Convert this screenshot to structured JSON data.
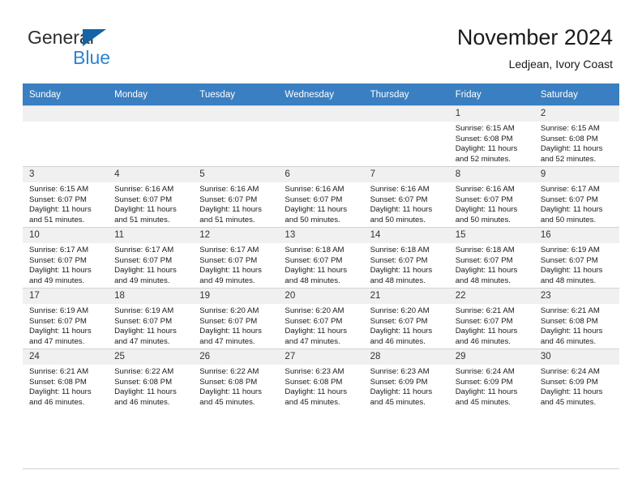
{
  "brand": {
    "name_part1": "General",
    "name_part2": "Blue",
    "logo_icon": "blue-triangle-logo"
  },
  "header": {
    "title": "November 2024",
    "subtitle": "Ledjean, Ivory Coast"
  },
  "calendar": {
    "weekday_headers": [
      "Sunday",
      "Monday",
      "Tuesday",
      "Wednesday",
      "Thursday",
      "Friday",
      "Saturday"
    ],
    "labels": {
      "sunrise_prefix": "Sunrise:",
      "sunset_prefix": "Sunset:",
      "daylight_prefix": "Daylight:"
    },
    "weeks": [
      [
        {
          "day": "",
          "empty": true
        },
        {
          "day": "",
          "empty": true
        },
        {
          "day": "",
          "empty": true
        },
        {
          "day": "",
          "empty": true
        },
        {
          "day": "",
          "empty": true
        },
        {
          "day": "1",
          "sunrise": "Sunrise: 6:15 AM",
          "sunset": "Sunset: 6:08 PM",
          "daylight": "Daylight: 11 hours and 52 minutes."
        },
        {
          "day": "2",
          "sunrise": "Sunrise: 6:15 AM",
          "sunset": "Sunset: 6:08 PM",
          "daylight": "Daylight: 11 hours and 52 minutes."
        }
      ],
      [
        {
          "day": "3",
          "sunrise": "Sunrise: 6:15 AM",
          "sunset": "Sunset: 6:07 PM",
          "daylight": "Daylight: 11 hours and 51 minutes."
        },
        {
          "day": "4",
          "sunrise": "Sunrise: 6:16 AM",
          "sunset": "Sunset: 6:07 PM",
          "daylight": "Daylight: 11 hours and 51 minutes."
        },
        {
          "day": "5",
          "sunrise": "Sunrise: 6:16 AM",
          "sunset": "Sunset: 6:07 PM",
          "daylight": "Daylight: 11 hours and 51 minutes."
        },
        {
          "day": "6",
          "sunrise": "Sunrise: 6:16 AM",
          "sunset": "Sunset: 6:07 PM",
          "daylight": "Daylight: 11 hours and 50 minutes."
        },
        {
          "day": "7",
          "sunrise": "Sunrise: 6:16 AM",
          "sunset": "Sunset: 6:07 PM",
          "daylight": "Daylight: 11 hours and 50 minutes."
        },
        {
          "day": "8",
          "sunrise": "Sunrise: 6:16 AM",
          "sunset": "Sunset: 6:07 PM",
          "daylight": "Daylight: 11 hours and 50 minutes."
        },
        {
          "day": "9",
          "sunrise": "Sunrise: 6:17 AM",
          "sunset": "Sunset: 6:07 PM",
          "daylight": "Daylight: 11 hours and 50 minutes."
        }
      ],
      [
        {
          "day": "10",
          "sunrise": "Sunrise: 6:17 AM",
          "sunset": "Sunset: 6:07 PM",
          "daylight": "Daylight: 11 hours and 49 minutes."
        },
        {
          "day": "11",
          "sunrise": "Sunrise: 6:17 AM",
          "sunset": "Sunset: 6:07 PM",
          "daylight": "Daylight: 11 hours and 49 minutes."
        },
        {
          "day": "12",
          "sunrise": "Sunrise: 6:17 AM",
          "sunset": "Sunset: 6:07 PM",
          "daylight": "Daylight: 11 hours and 49 minutes."
        },
        {
          "day": "13",
          "sunrise": "Sunrise: 6:18 AM",
          "sunset": "Sunset: 6:07 PM",
          "daylight": "Daylight: 11 hours and 48 minutes."
        },
        {
          "day": "14",
          "sunrise": "Sunrise: 6:18 AM",
          "sunset": "Sunset: 6:07 PM",
          "daylight": "Daylight: 11 hours and 48 minutes."
        },
        {
          "day": "15",
          "sunrise": "Sunrise: 6:18 AM",
          "sunset": "Sunset: 6:07 PM",
          "daylight": "Daylight: 11 hours and 48 minutes."
        },
        {
          "day": "16",
          "sunrise": "Sunrise: 6:19 AM",
          "sunset": "Sunset: 6:07 PM",
          "daylight": "Daylight: 11 hours and 48 minutes."
        }
      ],
      [
        {
          "day": "17",
          "sunrise": "Sunrise: 6:19 AM",
          "sunset": "Sunset: 6:07 PM",
          "daylight": "Daylight: 11 hours and 47 minutes."
        },
        {
          "day": "18",
          "sunrise": "Sunrise: 6:19 AM",
          "sunset": "Sunset: 6:07 PM",
          "daylight": "Daylight: 11 hours and 47 minutes."
        },
        {
          "day": "19",
          "sunrise": "Sunrise: 6:20 AM",
          "sunset": "Sunset: 6:07 PM",
          "daylight": "Daylight: 11 hours and 47 minutes."
        },
        {
          "day": "20",
          "sunrise": "Sunrise: 6:20 AM",
          "sunset": "Sunset: 6:07 PM",
          "daylight": "Daylight: 11 hours and 47 minutes."
        },
        {
          "day": "21",
          "sunrise": "Sunrise: 6:20 AM",
          "sunset": "Sunset: 6:07 PM",
          "daylight": "Daylight: 11 hours and 46 minutes."
        },
        {
          "day": "22",
          "sunrise": "Sunrise: 6:21 AM",
          "sunset": "Sunset: 6:07 PM",
          "daylight": "Daylight: 11 hours and 46 minutes."
        },
        {
          "day": "23",
          "sunrise": "Sunrise: 6:21 AM",
          "sunset": "Sunset: 6:08 PM",
          "daylight": "Daylight: 11 hours and 46 minutes."
        }
      ],
      [
        {
          "day": "24",
          "sunrise": "Sunrise: 6:21 AM",
          "sunset": "Sunset: 6:08 PM",
          "daylight": "Daylight: 11 hours and 46 minutes."
        },
        {
          "day": "25",
          "sunrise": "Sunrise: 6:22 AM",
          "sunset": "Sunset: 6:08 PM",
          "daylight": "Daylight: 11 hours and 46 minutes."
        },
        {
          "day": "26",
          "sunrise": "Sunrise: 6:22 AM",
          "sunset": "Sunset: 6:08 PM",
          "daylight": "Daylight: 11 hours and 45 minutes."
        },
        {
          "day": "27",
          "sunrise": "Sunrise: 6:23 AM",
          "sunset": "Sunset: 6:08 PM",
          "daylight": "Daylight: 11 hours and 45 minutes."
        },
        {
          "day": "28",
          "sunrise": "Sunrise: 6:23 AM",
          "sunset": "Sunset: 6:09 PM",
          "daylight": "Daylight: 11 hours and 45 minutes."
        },
        {
          "day": "29",
          "sunrise": "Sunrise: 6:24 AM",
          "sunset": "Sunset: 6:09 PM",
          "daylight": "Daylight: 11 hours and 45 minutes."
        },
        {
          "day": "30",
          "sunrise": "Sunrise: 6:24 AM",
          "sunset": "Sunset: 6:09 PM",
          "daylight": "Daylight: 11 hours and 45 minutes."
        }
      ]
    ]
  },
  "colors": {
    "header_blue": "#3a7fc1",
    "brand_blue": "#2b84d4",
    "logo_blue": "#1464a5",
    "daynum_bg": "#f0f0f0",
    "grid_line": "#d3d3d3"
  }
}
